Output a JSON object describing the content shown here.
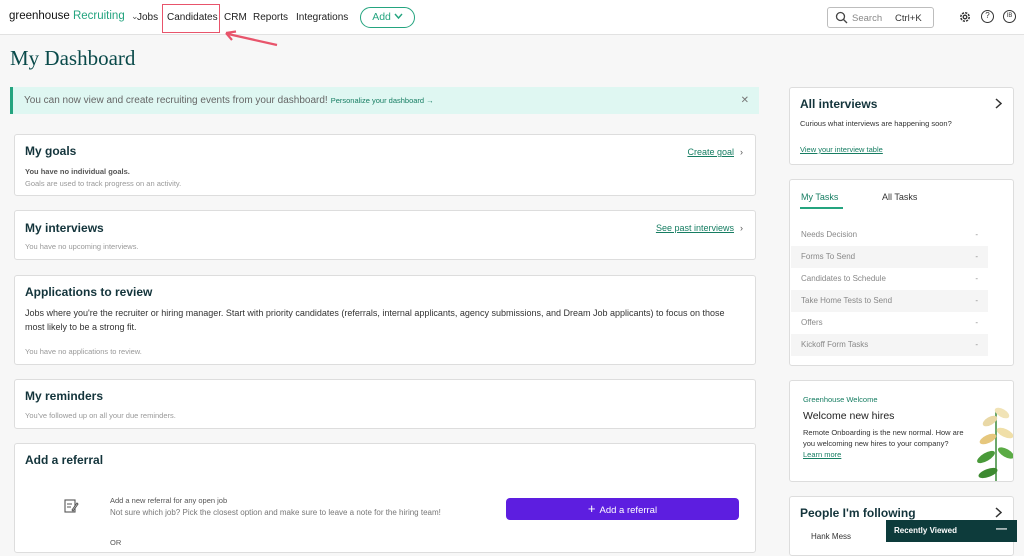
{
  "brand": {
    "name_a": "greenhouse",
    "name_b": "Recruiting"
  },
  "nav": {
    "jobs": "Jobs",
    "candidates": "Candidates",
    "crm": "CRM",
    "reports": "Reports",
    "integrations": "Integrations",
    "add": "Add"
  },
  "search": {
    "placeholder": "Search",
    "shortcut": "Ctrl+K"
  },
  "user": {
    "initials": "IB"
  },
  "page_title": "My Dashboard",
  "banner": {
    "text": "You can now view and create recruiting events from your dashboard!",
    "link": "Personalize your dashboard →"
  },
  "goals": {
    "title": "My goals",
    "link": "Create goal",
    "empty": "You have no individual goals.",
    "hint": "Goals are used to track progress on an activity."
  },
  "interviews": {
    "title": "My interviews",
    "link": "See past interviews",
    "empty": "You have no upcoming interviews."
  },
  "applications": {
    "title": "Applications to review",
    "description": "Jobs where you're the recruiter or hiring manager. Start with priority candidates (referrals, internal applicants, agency submissions, and Dream Job applicants) to focus on those most likely to be a strong fit.",
    "empty": "You have no applications to review."
  },
  "reminders": {
    "title": "My reminders",
    "empty": "You've followed up on all your due reminders."
  },
  "referral": {
    "title": "Add a referral",
    "line1": "Add a new referral for any open job",
    "line2": "Not sure which job? Pick the closest option and make sure to leave a note for the hiring team!",
    "button": "Add a referral",
    "or": "OR"
  },
  "all_interviews": {
    "title": "All interviews",
    "subtitle": "Curious what interviews are happening soon?",
    "link": "View your interview table"
  },
  "tasks": {
    "tabs": [
      "My Tasks",
      "All Tasks"
    ],
    "items": [
      {
        "label": "Needs Decision",
        "value": "-"
      },
      {
        "label": "Forms To Send",
        "value": "-"
      },
      {
        "label": "Candidates to Schedule",
        "value": "-"
      },
      {
        "label": "Take Home Tests to Send",
        "value": "-"
      },
      {
        "label": "Offers",
        "value": "-"
      },
      {
        "label": "Kickoff Form Tasks",
        "value": "-"
      }
    ]
  },
  "welcome": {
    "eyebrow": "Greenhouse Welcome",
    "title": "Welcome new hires",
    "body": "Remote Onboarding is the new normal. How are you welcoming new hires to your company?",
    "link": "Learn more"
  },
  "following": {
    "title": "People I'm following",
    "person": "Hank Mess"
  },
  "recently_viewed": "Recently Viewed",
  "colors": {
    "brand_green": "#24a47f",
    "primary_purple": "#5d1ee0",
    "title_teal": "#0a4a4a",
    "highlight_red": "#e8546b"
  }
}
